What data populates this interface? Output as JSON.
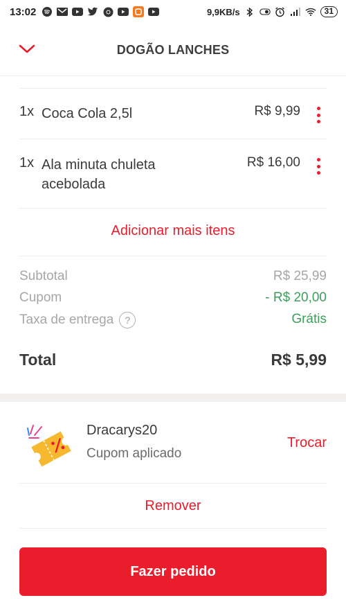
{
  "status_bar": {
    "time": "13:02",
    "network_speed": "9,9KB/s",
    "battery": "31",
    "icons_left": [
      "spotify-icon",
      "gmail-icon",
      "youtube-icon",
      "twitter-icon",
      "chrome-icon",
      "youtube-icon",
      "app-icon",
      "youtube-icon"
    ],
    "icons_right": [
      "bluetooth-icon",
      "toggle-icon",
      "alarm-icon",
      "signal-icon",
      "wifi-icon",
      "battery-icon"
    ]
  },
  "header": {
    "title": "DOGÃO LANCHES",
    "back_icon": "chevron-down-icon"
  },
  "items": [
    {
      "qty": "1x",
      "name": "Coca Cola 2,5l",
      "price": "R$ 9,99"
    },
    {
      "qty": "1x",
      "name": "Ala minuta chuleta acebolada",
      "price": "R$ 16,00"
    }
  ],
  "add_more_label": "Adicionar mais itens",
  "summary": {
    "subtotal_label": "Subtotal",
    "subtotal_value": "R$ 25,99",
    "coupon_label": "Cupom",
    "coupon_value": "- R$ 20,00",
    "delivery_label": "Taxa de entrega",
    "delivery_help": "?",
    "delivery_value": "Grátis",
    "total_label": "Total",
    "total_value": "R$ 5,99"
  },
  "coupon": {
    "code": "Dracarys20",
    "status": "Cupom aplicado",
    "change_label": "Trocar",
    "remove_label": "Remover"
  },
  "cta_label": "Fazer pedido",
  "colors": {
    "accent": "#ea1d2c",
    "green": "#3b9e5a",
    "muted": "#a6a6a6",
    "band": "#f2f0ee"
  }
}
